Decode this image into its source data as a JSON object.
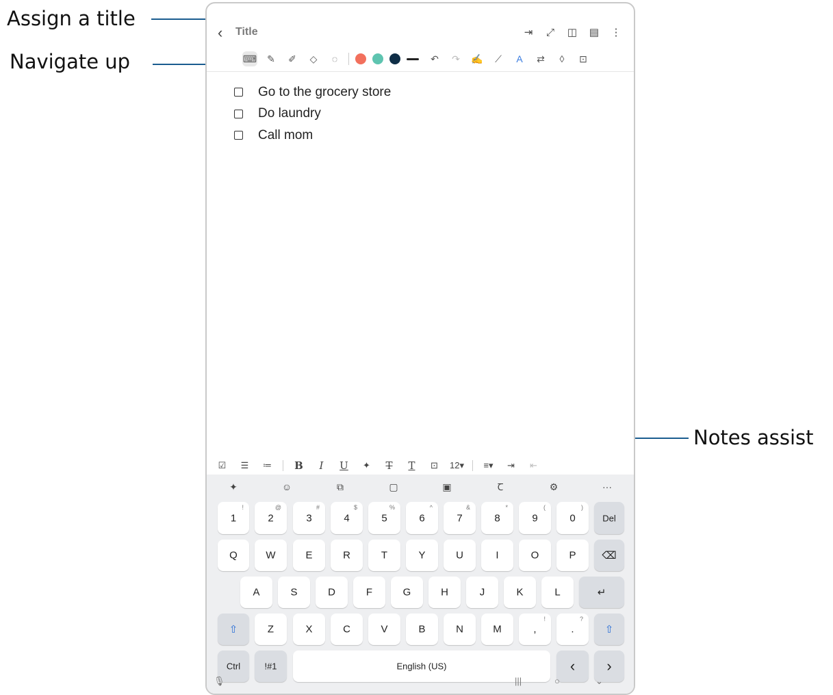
{
  "callouts": {
    "assign_title": "Assign a title",
    "navigate_up": "Navigate up",
    "notes_assist": "Notes assist"
  },
  "header": {
    "back_icon": "‹",
    "title_placeholder": "Title",
    "icons": [
      "export-icon",
      "expand-icon",
      "book-view-icon",
      "page-view-icon",
      "more-options-icon"
    ]
  },
  "toolbar": {
    "tools": [
      "keyboard-icon",
      "pen-icon",
      "highlighter-icon",
      "eraser-icon",
      "lasso-icon"
    ],
    "colors": [
      "#f2705d",
      "#5ec4b0",
      "#0f2e47"
    ],
    "actions": [
      "undo-icon",
      "redo-icon",
      "handwriting-icon",
      "straighten-icon",
      "text-style-icon",
      "convert-text-icon",
      "shape-icon",
      "lock-icon"
    ]
  },
  "checklist": [
    {
      "text": "Go to the grocery store"
    },
    {
      "text": "Do laundry"
    },
    {
      "text": "Call mom"
    }
  ],
  "format_bar": {
    "bold": "B",
    "italic": "I",
    "underline": "U",
    "font_size": "12"
  },
  "keyboard": {
    "number_row": [
      {
        "main": "1",
        "sup": "!"
      },
      {
        "main": "2",
        "sup": "@"
      },
      {
        "main": "3",
        "sup": "#"
      },
      {
        "main": "4",
        "sup": "$"
      },
      {
        "main": "5",
        "sup": "%"
      },
      {
        "main": "6",
        "sup": "^"
      },
      {
        "main": "7",
        "sup": "&"
      },
      {
        "main": "8",
        "sup": "*"
      },
      {
        "main": "9",
        "sup": "("
      },
      {
        "main": "0",
        "sup": ")"
      }
    ],
    "del": "Del",
    "row_q": [
      "Q",
      "W",
      "E",
      "R",
      "T",
      "Y",
      "U",
      "I",
      "O",
      "P"
    ],
    "row_a": [
      "A",
      "S",
      "D",
      "F",
      "G",
      "H",
      "J",
      "K",
      "L"
    ],
    "row_z": [
      "Z",
      "X",
      "C",
      "V",
      "B",
      "N",
      "M"
    ],
    "comma": {
      "main": ",",
      "sup": "!"
    },
    "period": {
      "main": ".",
      "sup": "?"
    },
    "ctrl": "Ctrl",
    "symbols": "!#1",
    "space": "English (US)",
    "left": "‹",
    "right": "›"
  }
}
